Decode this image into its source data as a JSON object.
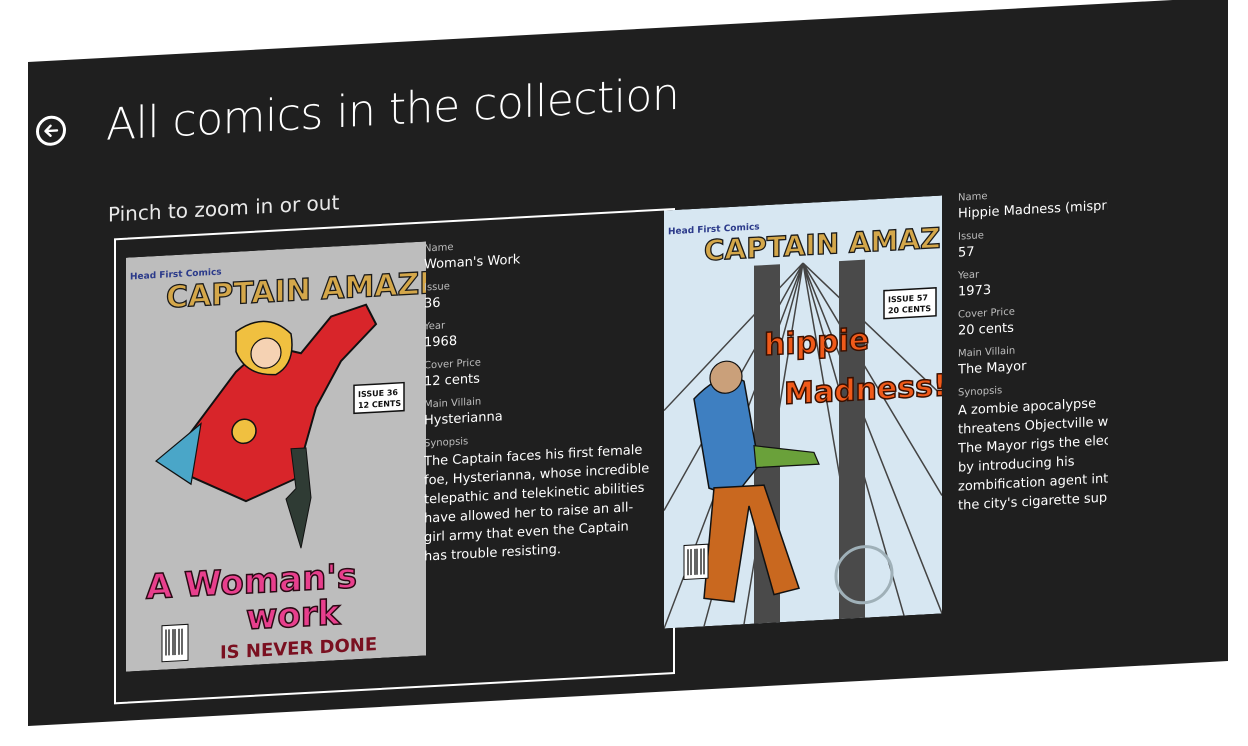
{
  "header": {
    "title": "All comics in the collection",
    "subtitle": "Pinch to zoom in or out"
  },
  "comics": [
    {
      "cover": {
        "publisher": "Head First Comics",
        "series": "CAPTAIN AMAZING",
        "issue_badge": "ISSUE 36",
        "price_badge": "12 CENTS",
        "headline_top": "A Woman's",
        "headline_mid": "work",
        "headline_bottom": "IS NEVER DONE",
        "paper_color": "#c9c9c9",
        "accent_color": "#e83f8d"
      },
      "labels": {
        "name": "Name",
        "issue": "Issue",
        "year": "Year",
        "cover_price": "Cover Price",
        "main_villain": "Main Villain",
        "synopsis": "Synopsis"
      },
      "name": "Woman's Work",
      "issue": "36",
      "year": "1968",
      "cover_price": "12 cents",
      "main_villain": "Hysterianna",
      "synopsis": "The Captain faces his first female foe, Hysterianna, whose incredible telepathic and telekinetic abilities have allowed her to raise an all-girl army that even the Captain has trouble resisting."
    },
    {
      "cover": {
        "publisher": "Head First Comics",
        "series": "CAPTAIN AMAZING",
        "issue_badge": "ISSUE 57",
        "price_badge": "20 CENTS",
        "headline_top": "hippie",
        "headline_mid": "Madness!",
        "paper_color": "#d7e7f2",
        "accent_color": "#f05a1a"
      },
      "labels": {
        "name": "Name",
        "issue": "Issue",
        "year": "Year",
        "cover_price": "Cover Price",
        "main_villain": "Main Villain",
        "synopsis": "Synopsis"
      },
      "name": "Hippie Madness (misprinted)",
      "issue": "57",
      "year": "1973",
      "cover_price": "20 cents",
      "main_villain": "The Mayor",
      "synopsis": "A zombie apocalypse threatens Objectville when The Mayor rigs the election by introducing his zombification agent into the city's cigarette supply."
    }
  ]
}
